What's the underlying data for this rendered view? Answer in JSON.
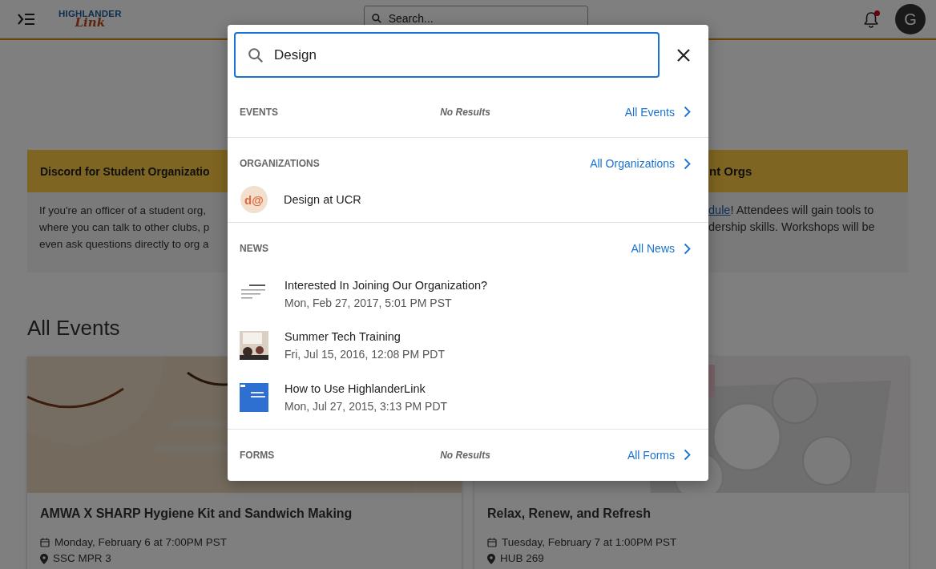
{
  "header": {
    "logo": {
      "top": "HIGHLANDER",
      "bottom": "Link"
    },
    "search": {
      "placeholder": "Search..."
    },
    "notifications": {
      "unread": true
    },
    "avatar": "G"
  },
  "announcement": {
    "title_fragments": [
      "Discord for Student Organizatio",
      "nt Orgs"
    ],
    "left_lines": [
      "If you're an officer of a student org,",
      "where you can talk to other clubs, p",
      "even ask questions directly to org a"
    ],
    "right_lines": [
      {
        "link": "dule",
        "text": "! Attendees will gain tools to"
      },
      {
        "text": "dership skills. Workshops will be"
      }
    ]
  },
  "events_title": "All Events",
  "events": [
    {
      "title": "AMWA X SHARP Hygiene Kit and Sandwich Making",
      "date": "Monday, February 6 at 7:00PM PST",
      "location": "SSC MPR 3"
    },
    {
      "title": "Relax, Renew, and Refresh",
      "date": "Tuesday, February 7 at 1:00PM PST",
      "location": "HUB 269"
    }
  ],
  "search_modal": {
    "value": "Design",
    "sections": [
      {
        "title": "EVENTS",
        "no_results": "No Results",
        "link": "All Events"
      },
      {
        "title": "ORGANIZATIONS",
        "link": "All Organizations",
        "items": [
          {
            "kind": "org",
            "avatar": "d@",
            "name": "Design at UCR"
          }
        ]
      },
      {
        "title": "NEWS",
        "link": "All News",
        "items": [
          {
            "kind": "news",
            "name": "Interested In Joining Our Organization?",
            "date": "Mon, Feb 27, 2017, 5:01 PM PST"
          },
          {
            "kind": "news",
            "name": "Summer Tech Training",
            "date": "Fri, Jul 15, 2016, 12:08 PM PDT"
          },
          {
            "kind": "news",
            "name": "How to Use HighlanderLink",
            "date": "Mon, Jul 27, 2015, 3:13 PM PDT"
          }
        ]
      },
      {
        "title": "FORMS",
        "no_results": "No Results",
        "link": "All Forms"
      }
    ]
  }
}
